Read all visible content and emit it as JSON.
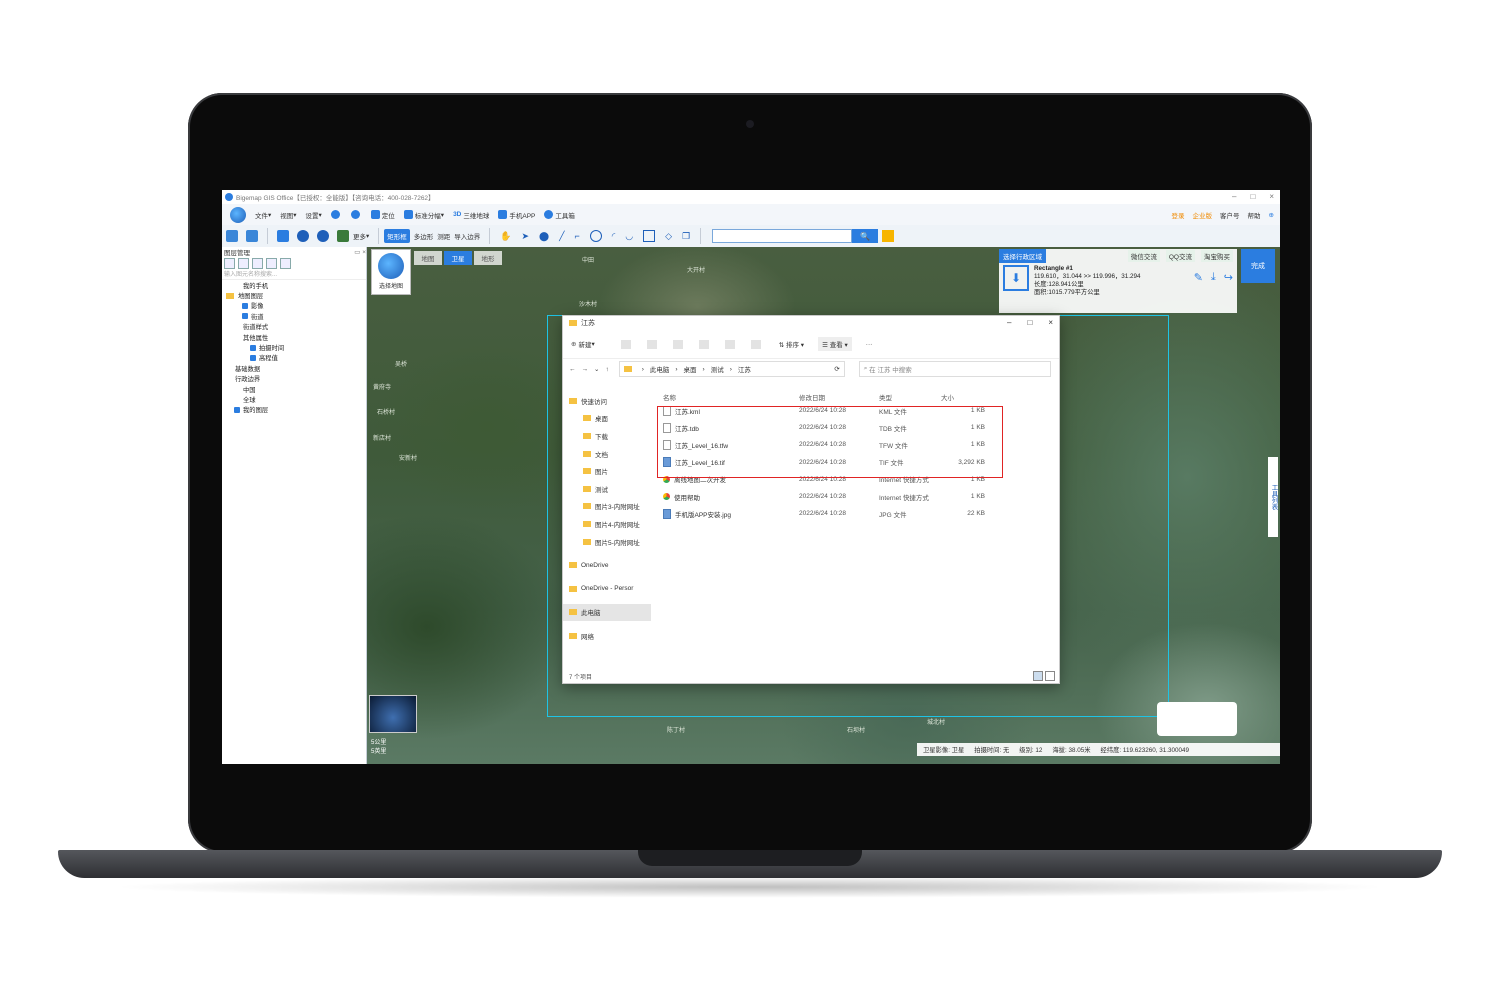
{
  "window": {
    "title": "Bigemap GIS Office【已授权：全能版】【咨询电话：400-028-7262】"
  },
  "menubar": {
    "items": [
      "文件",
      "视图",
      "设置",
      "定位",
      "标准分幅",
      "三维地球",
      "手机APP",
      "工具箱"
    ],
    "three_d_label": "3D",
    "right_items": [
      "登录",
      "企业版",
      "客户号",
      "帮助"
    ]
  },
  "toolbar": {
    "more_label": "更多",
    "rect_label": "矩形框",
    "polygon_label": "多边形",
    "measure_label": "测距",
    "import_boundary_label": "导入边界",
    "search_button": "🔍"
  },
  "left_panel": {
    "title": "图层管理",
    "search_placeholder": "输入图元名称搜索...",
    "tree": [
      {
        "label": "我的手机",
        "indent": 1,
        "check": "none"
      },
      {
        "label": "地图图层",
        "indent": 0,
        "check": "folder"
      },
      {
        "label": "影像",
        "indent": 2,
        "check": "on"
      },
      {
        "label": "街道",
        "indent": 2,
        "check": "on"
      },
      {
        "label": "街道样式",
        "indent": 1,
        "check": "none"
      },
      {
        "label": "其他属性",
        "indent": 1,
        "check": "none"
      },
      {
        "label": "拍摄时间",
        "indent": 3,
        "check": "on"
      },
      {
        "label": "高程值",
        "indent": 3,
        "check": "on"
      },
      {
        "label": "基础数据",
        "indent": 0,
        "check": "none"
      },
      {
        "label": "行政边界",
        "indent": 0,
        "check": "none"
      },
      {
        "label": "中国",
        "indent": 1,
        "check": "none"
      },
      {
        "label": "全球",
        "indent": 1,
        "check": "none"
      },
      {
        "label": "我的图层",
        "indent": 1,
        "check": "on"
      }
    ]
  },
  "map": {
    "tabs": [
      "地图",
      "卫星",
      "地形"
    ],
    "active_tab": "卫星",
    "map_select_label": "选择地图",
    "place_labels": [
      "大开村",
      "沙木村",
      "中田",
      "黄府寺",
      "石桥村",
      "新店村",
      "吴桥",
      "安新村",
      "陈丁村",
      "石坝村",
      "城北村"
    ],
    "scale_label_1": "5公里",
    "scale_label_2": "5英里"
  },
  "right_panel": {
    "tab_label": "选择行政区域",
    "links": [
      "微信交流",
      "QQ交流",
      "淘宝购买"
    ],
    "shape_name": "Rectangle #1",
    "coords": "119.610，31.044 >> 119.996，31.294",
    "perimeter": "长度:128.941公里",
    "area": "面积:1015.779平方公里",
    "done_label": "完成",
    "tool_list_label": "工具列表"
  },
  "status_bar": {
    "source": "卫星影像: 卫星",
    "capture_time": "拍摄时间: 无",
    "level": "级别: 12",
    "altitude": "海拔: 38.05米",
    "lonlat": "经纬度: 119.623260, 31.300049"
  },
  "explorer": {
    "title": "江苏",
    "new_label": "新建",
    "sort_label": "排序",
    "view_label": "查看",
    "more_label": "···",
    "breadcrumb": [
      "此电脑",
      "桌面",
      "测试",
      "江苏"
    ],
    "search_placeholder": "在 江苏 中搜索",
    "columns": [
      "名称",
      "修改日期",
      "类型",
      "大小"
    ],
    "sidebar": [
      {
        "label": "快速访问",
        "top": true
      },
      {
        "label": "桌面"
      },
      {
        "label": "下载"
      },
      {
        "label": "文档"
      },
      {
        "label": "图片"
      },
      {
        "label": "测试"
      },
      {
        "label": "图片3-内附网址"
      },
      {
        "label": "图片4-内附网址"
      },
      {
        "label": "图片5-内附网址"
      },
      {
        "label": "OneDrive",
        "top": true
      },
      {
        "label": "OneDrive - Persor",
        "top": true
      },
      {
        "label": "此电脑",
        "top": true,
        "selected": true
      },
      {
        "label": "网络",
        "top": true
      }
    ],
    "files": [
      {
        "name": "江苏.kml",
        "date": "2022/6/24 10:28",
        "type": "KML 文件",
        "size": "1 KB",
        "icon": "file"
      },
      {
        "name": "江苏.tdb",
        "date": "2022/6/24 10:28",
        "type": "TDB 文件",
        "size": "1 KB",
        "icon": "file"
      },
      {
        "name": "江苏_Level_16.tfw",
        "date": "2022/6/24 10:28",
        "type": "TFW 文件",
        "size": "1 KB",
        "icon": "file"
      },
      {
        "name": "江苏_Level_16.tif",
        "date": "2022/6/24 10:28",
        "type": "TIF 文件",
        "size": "3,292 KB",
        "icon": "img"
      },
      {
        "name": "离线地图二次开发",
        "date": "2022/6/24 10:28",
        "type": "Internet 快捷方式",
        "size": "1 KB",
        "icon": "link"
      },
      {
        "name": "使用帮助",
        "date": "2022/6/24 10:28",
        "type": "Internet 快捷方式",
        "size": "1 KB",
        "icon": "link"
      },
      {
        "name": "手机版APP安装.jpg",
        "date": "2022/6/24 10:28",
        "type": "JPG 文件",
        "size": "22 KB",
        "icon": "img"
      }
    ],
    "item_count": "7 个项目"
  }
}
